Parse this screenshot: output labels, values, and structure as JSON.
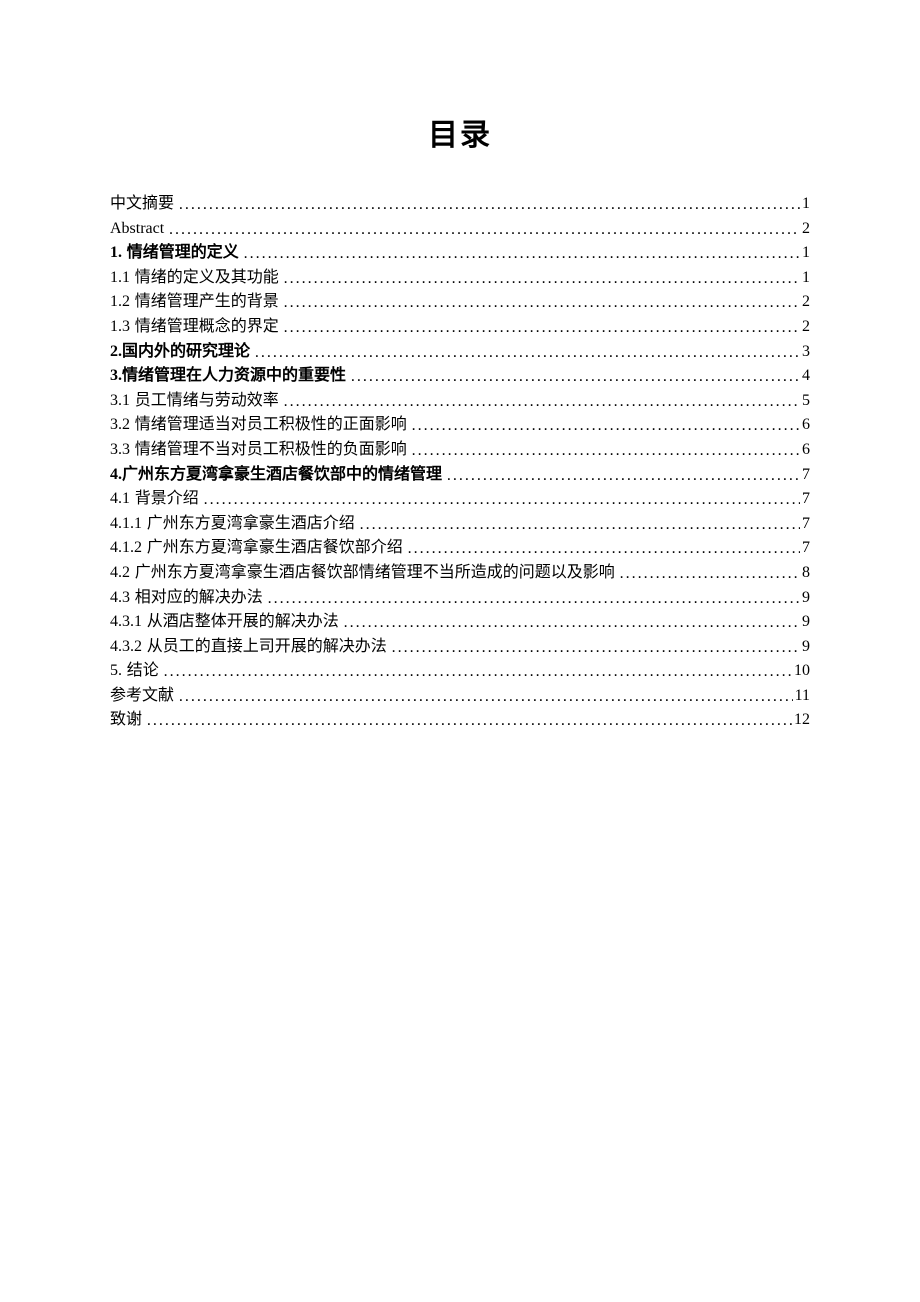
{
  "title": "目录",
  "toc": [
    {
      "num": "",
      "text": "中文摘要",
      "page": "1",
      "bold": false,
      "spaceAfterNum": false
    },
    {
      "num": "",
      "text": "Abstract",
      "page": "2",
      "bold": false,
      "spaceAfterNum": false,
      "latin": true
    },
    {
      "num": "1.",
      "text": "情绪管理的定义",
      "page": "1",
      "bold": true,
      "spaceAfterNum": true
    },
    {
      "num": "1.1",
      "text": "情绪的定义及其功能",
      "page": "1",
      "bold": false,
      "spaceAfterNum": true
    },
    {
      "num": "1.2",
      "text": "情绪管理产生的背景",
      "page": "2",
      "bold": false,
      "spaceAfterNum": true
    },
    {
      "num": "1.3",
      "text": "情绪管理概念的界定",
      "page": "2",
      "bold": false,
      "spaceAfterNum": true
    },
    {
      "num": "2.",
      "text": "国内外的研究理论",
      "page": "3",
      "bold": true,
      "spaceAfterNum": false
    },
    {
      "num": "3.",
      "text": "情绪管理在人力资源中的重要性",
      "page": "4",
      "bold": true,
      "spaceAfterNum": false
    },
    {
      "num": "3.1",
      "text": "员工情绪与劳动效率",
      "page": "5",
      "bold": false,
      "spaceAfterNum": true
    },
    {
      "num": "3.2",
      "text": "情绪管理适当对员工积极性的正面影响",
      "page": "6",
      "bold": false,
      "spaceAfterNum": true
    },
    {
      "num": "3.3",
      "text": "情绪管理不当对员工积极性的负面影响",
      "page": "6",
      "bold": false,
      "spaceAfterNum": true
    },
    {
      "num": "4.",
      "text": "广州东方夏湾拿豪生酒店餐饮部中的情绪管理",
      "page": "7",
      "bold": true,
      "spaceAfterNum": false
    },
    {
      "num": "4.1",
      "text": "背景介绍",
      "page": "7",
      "bold": false,
      "spaceAfterNum": true
    },
    {
      "num": "4.1.1",
      "text": "广州东方夏湾拿豪生酒店介绍",
      "page": "7",
      "bold": false,
      "spaceAfterNum": true
    },
    {
      "num": "4.1.2",
      "text": "广州东方夏湾拿豪生酒店餐饮部介绍",
      "page": "7",
      "bold": false,
      "spaceAfterNum": true
    },
    {
      "num": "4.2",
      "text": "广州东方夏湾拿豪生酒店餐饮部情绪管理不当所造成的问题以及影响",
      "page": "8",
      "bold": false,
      "spaceAfterNum": true
    },
    {
      "num": "4.3",
      "text": "相对应的解决办法",
      "page": "9",
      "bold": false,
      "spaceAfterNum": true
    },
    {
      "num": "4.3.1",
      "text": "从酒店整体开展的解决办法",
      "page": "9",
      "bold": false,
      "spaceAfterNum": true
    },
    {
      "num": "4.3.2",
      "text": "从员工的直接上司开展的解决办法",
      "page": "9",
      "bold": false,
      "spaceAfterNum": true
    },
    {
      "num": "5.",
      "text": "结论",
      "page": "10",
      "bold": false,
      "spaceAfterNum": true
    },
    {
      "num": "",
      "text": "参考文献",
      "page": "11",
      "bold": false,
      "spaceAfterNum": false
    },
    {
      "num": "",
      "text": "致谢",
      "page": "12",
      "bold": false,
      "spaceAfterNum": false
    }
  ]
}
